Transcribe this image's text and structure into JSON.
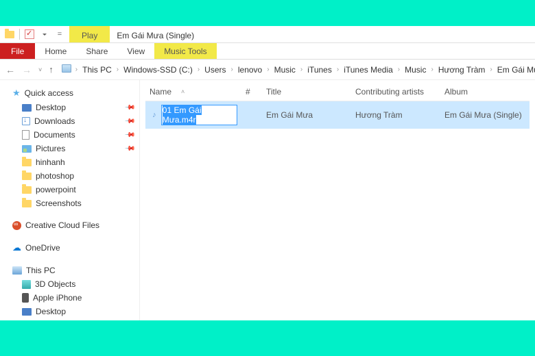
{
  "titlebar": {
    "contextual_label": "Play",
    "window_title": "Em Gái Mưa (Single)"
  },
  "ribbon": {
    "file": "File",
    "home": "Home",
    "share": "Share",
    "view": "View",
    "music_tools": "Music Tools"
  },
  "breadcrumb": {
    "items": [
      "This PC",
      "Windows-SSD (C:)",
      "Users",
      "lenovo",
      "Music",
      "iTunes",
      "iTunes Media",
      "Music",
      "Hương Tràm",
      "Em Gái Mưa (Single)"
    ]
  },
  "sidebar": {
    "quick_access": "Quick access",
    "pinned": {
      "desktop": "Desktop",
      "downloads": "Downloads",
      "documents": "Documents",
      "pictures": "Pictures"
    },
    "recent": [
      "hinhanh",
      "photoshop",
      "powerpoint",
      "Screenshots"
    ],
    "creative_cloud": "Creative Cloud Files",
    "onedrive": "OneDrive",
    "this_pc": "This PC",
    "pc_items": {
      "objects3d": "3D Objects",
      "iphone": "Apple iPhone",
      "desktop": "Desktop"
    }
  },
  "columns": {
    "name": "Name",
    "num": "#",
    "title": "Title",
    "artists": "Contributing artists",
    "album": "Album"
  },
  "files": {
    "row0": {
      "rename_text": "01 Em Gái Mưa.m4r",
      "title": "Em Gái Mưa",
      "artists": "Hương Tràm",
      "album": "Em Gái Mưa (Single)"
    }
  }
}
